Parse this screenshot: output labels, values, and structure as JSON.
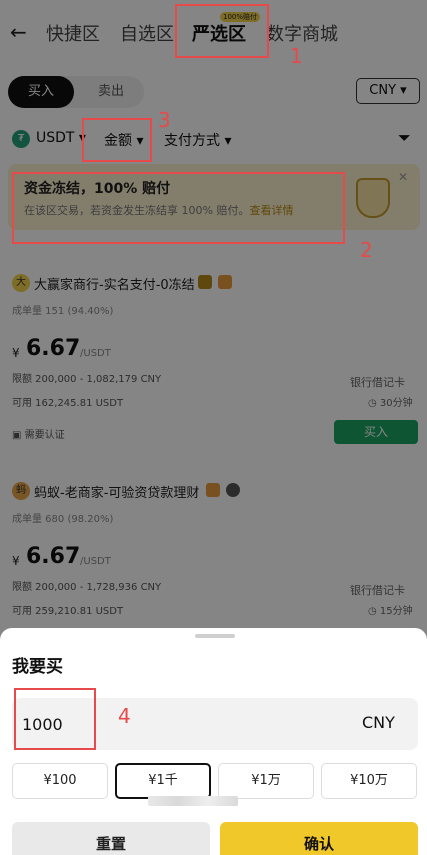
{
  "nav": {
    "back_icon": "back-arrow-icon",
    "tabs": [
      {
        "label": "快捷区"
      },
      {
        "label": "自选区"
      },
      {
        "label": "严选区",
        "tag": "100%赔付"
      },
      {
        "label": "数字商城"
      }
    ]
  },
  "trade_toggle": {
    "buy": "买入",
    "sell": "卖出"
  },
  "currency": "CNY",
  "filters": {
    "asset": "USDT",
    "amount": "金额",
    "payment": "支付方式"
  },
  "banner": {
    "title": "资金冻结，100% 赔付",
    "subtitle": "在该区交易，若资金发生冻结享 100% 赔付。",
    "link": "查看详情"
  },
  "merchants": [
    {
      "avatar": "大",
      "name": "大赢家商行-实名支付-0冻结",
      "stats": "成单量 151 (94.40%)",
      "currency_symbol": "¥",
      "price": "6.67",
      "unit": "/USDT",
      "limit": "限额 200,000 - 1,082,179 CNY",
      "available": "可用 162,245.81 USDT",
      "method": "银行借记卡",
      "time": "30分钟",
      "verify": "需要认证",
      "action": "买入"
    },
    {
      "avatar": "蚂",
      "name": "蚂蚁-老商家-可验资贷款理财",
      "stats": "成单量 680 (98.20%)",
      "currency_symbol": "¥",
      "price": "6.67",
      "unit": "/USDT",
      "limit": "限额 200,000 - 1,728,936 CNY",
      "available": "可用 259,210.81 USDT",
      "method": "银行借记卡",
      "time": "15分钟"
    }
  ],
  "sheet": {
    "title": "我要买",
    "amount_value": "1000",
    "amount_unit": "CNY",
    "quick_amounts": [
      "¥100",
      "¥1千",
      "¥1万",
      "¥10万"
    ],
    "selected_quick": 1,
    "reset": "重置",
    "confirm": "确认"
  },
  "annotations": [
    "1",
    "2",
    "3",
    "4"
  ],
  "colors": {
    "accent_yellow": "#f1c82a",
    "buy_green": "#1aa362",
    "annotation_red": "#e64a4a"
  }
}
